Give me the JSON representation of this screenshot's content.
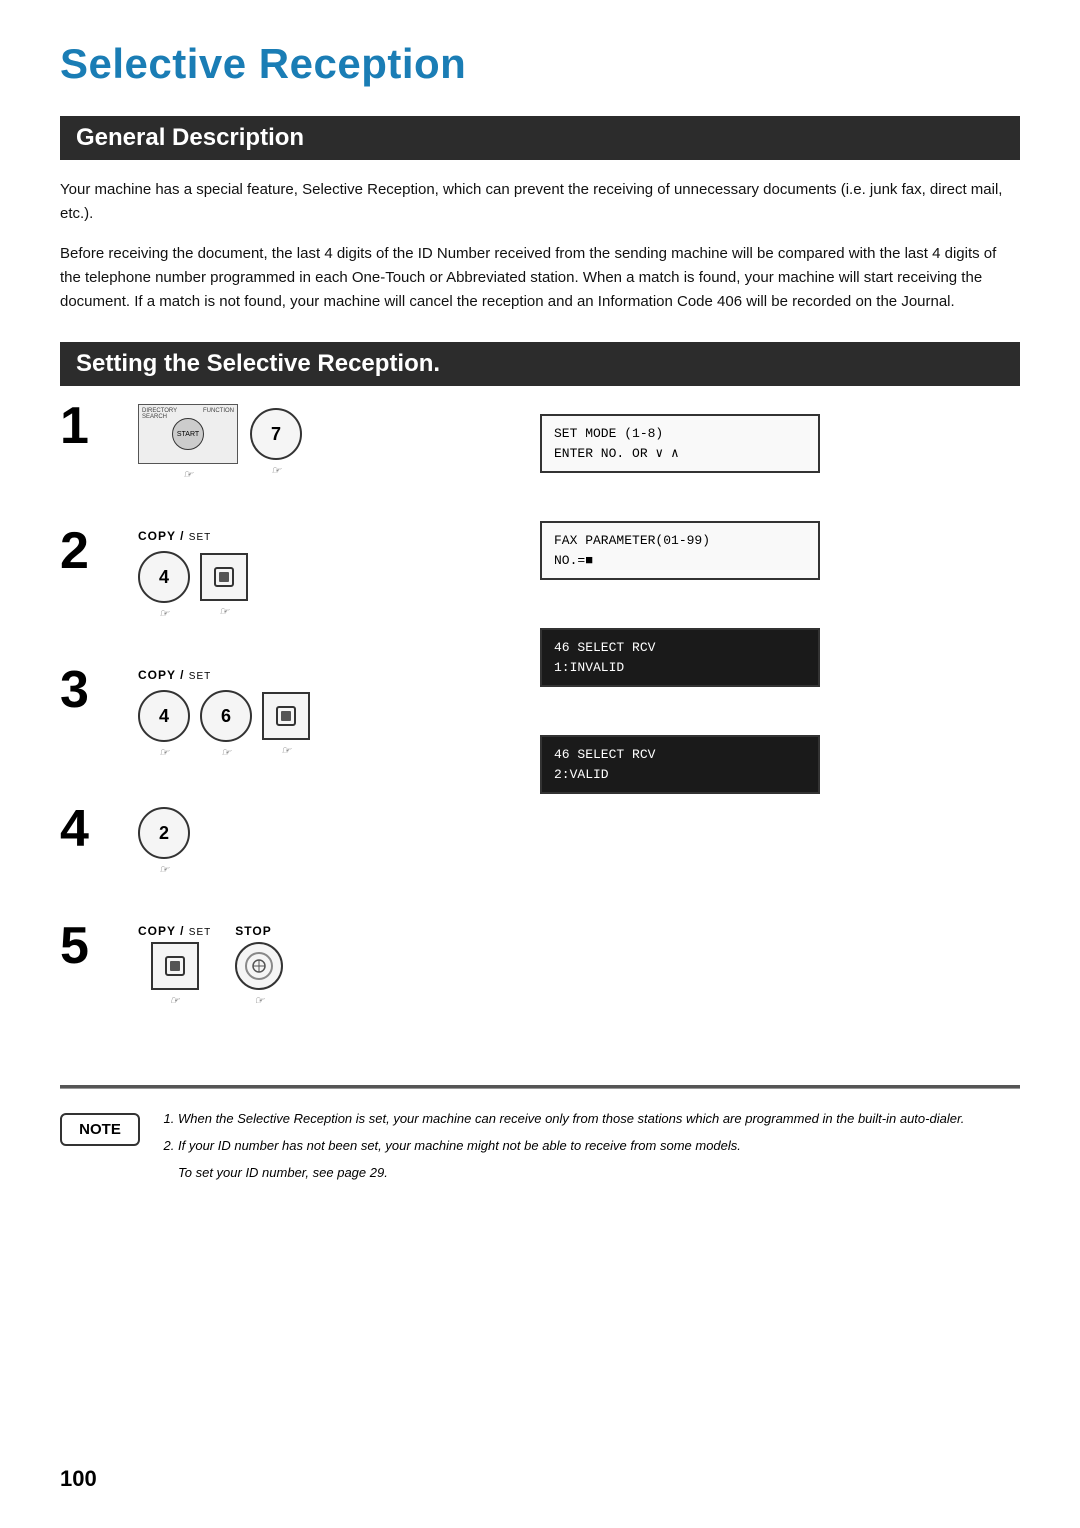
{
  "page": {
    "title": "Selective Reception",
    "page_number": "100"
  },
  "sections": {
    "general": {
      "header": "General Description",
      "paragraph1": "Your machine has a special feature, Selective Reception, which can prevent the receiving of unnecessary documents (i.e. junk fax, direct mail, etc.).",
      "paragraph2": "Before receiving the document, the last 4 digits of the ID Number received from the sending machine will be compared with the last 4 digits of the telephone number programmed in each One-Touch or Abbreviated station. When a match is found, your machine will start receiving the document. If a match is not found, your machine will cancel the reception and an Information Code 406 will be recorded on the Journal."
    },
    "setting": {
      "header": "Setting the Selective Reception."
    }
  },
  "steps": [
    {
      "number": "1",
      "has_label": false,
      "buttons": [
        "panel",
        "7"
      ],
      "display": {
        "type": "normal",
        "line1": "SET MODE       (1-8)",
        "line2": "ENTER NO. OR ∨ ∧"
      }
    },
    {
      "number": "2",
      "label": "COPY / SET",
      "buttons": [
        "4",
        "set"
      ],
      "display": {
        "type": "normal",
        "line1": "FAX PARAMETER(01-99)",
        "line2": "NO.=■"
      }
    },
    {
      "number": "3",
      "label": "COPY / SET",
      "buttons": [
        "4",
        "6",
        "set"
      ],
      "display": {
        "type": "dark",
        "line1": "46 SELECT RCV",
        "line2": "1:INVALID"
      }
    },
    {
      "number": "4",
      "has_label": false,
      "buttons": [
        "2"
      ],
      "display": {
        "type": "dark",
        "line1": "46 SELECT RCV",
        "line2": "2:VALID"
      }
    },
    {
      "number": "5",
      "label": "COPY / SET",
      "label2": "STOP",
      "buttons": [
        "set",
        "stop"
      ],
      "display": null
    }
  ],
  "note": {
    "label": "NOTE",
    "items": [
      "When the Selective Reception is set, your machine can receive only from those stations which are programmed in the built-in auto-dialer.",
      "If your ID number has not been set, your machine might not be able to receive from some models.",
      "To set your ID number, see page 29."
    ]
  }
}
